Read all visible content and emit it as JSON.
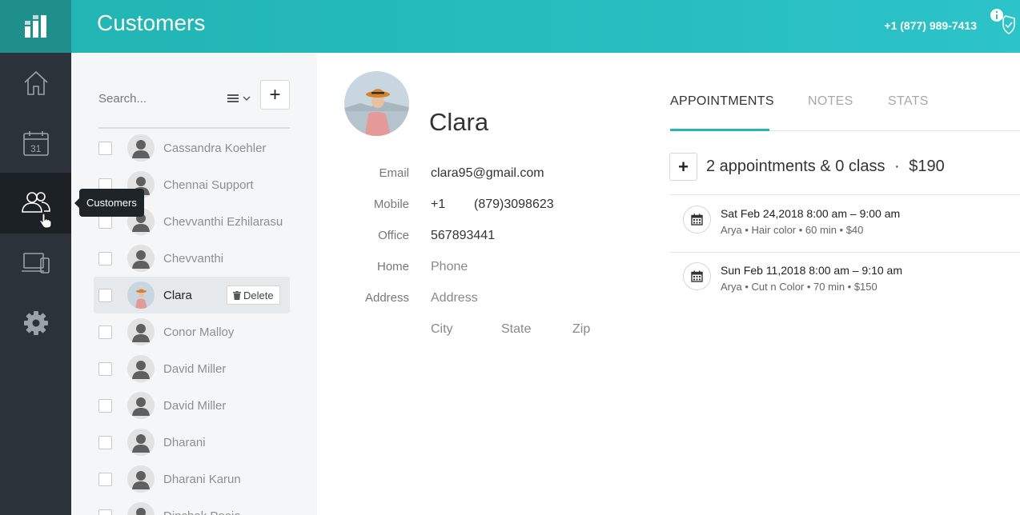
{
  "header": {
    "title": "Customers",
    "phone": "+1 (877) 989-7413",
    "bg_color": "#2cc3c9",
    "info_icon": "info-shield-icon"
  },
  "leftnav": {
    "items": [
      {
        "icon": "home-icon",
        "active": false
      },
      {
        "icon": "calendar-icon",
        "label": "31",
        "active": false
      },
      {
        "icon": "customers-icon",
        "active": true
      },
      {
        "icon": "devices-icon",
        "active": false
      },
      {
        "icon": "gear-icon",
        "active": false
      }
    ],
    "tooltip": "Customers"
  },
  "list": {
    "search_placeholder": "Search...",
    "add_label": "+",
    "delete_label": "Delete",
    "customers": [
      {
        "name": "Cassandra Koehler",
        "selected": false
      },
      {
        "name": "Chennai Support",
        "selected": false
      },
      {
        "name": "Chevvanthi Ezhilarasu",
        "selected": false
      },
      {
        "name": "Chevvanthi",
        "selected": false
      },
      {
        "name": "Clara",
        "selected": true
      },
      {
        "name": "Conor Malloy",
        "selected": false
      },
      {
        "name": "David Miller",
        "selected": false
      },
      {
        "name": "David Miller",
        "selected": false
      },
      {
        "name": "Dharani",
        "selected": false
      },
      {
        "name": "Dharani Karun",
        "selected": false
      },
      {
        "name": "Dinchak Pooja",
        "selected": false
      }
    ]
  },
  "detail": {
    "name": "Clara",
    "labels": {
      "email": "Email",
      "mobile": "Mobile",
      "office": "Office",
      "home": "Home",
      "address": "Address"
    },
    "email": "clara95@gmail.com",
    "mobile_code": "+1",
    "mobile_number": "(879)3098623",
    "office": "567893441",
    "home_placeholder": "Phone",
    "address_placeholder": "Address",
    "city_placeholder": "City",
    "state_placeholder": "State",
    "zip_placeholder": "Zip"
  },
  "tabs": [
    {
      "label": "APPOINTMENTS",
      "active": true
    },
    {
      "label": "NOTES",
      "active": false
    },
    {
      "label": "STATS",
      "active": false
    }
  ],
  "appointments": {
    "add_label": "+",
    "summary": "2 appointments & 0 class",
    "summary_sep": "·",
    "total": "$190",
    "items": [
      {
        "title": "Sat Feb 24,2018 8:00 am – 9:00 am",
        "subtitle": "Arya • Hair color • 60 min • $40"
      },
      {
        "title": "Sun Feb 11,2018 8:00 am – 9:10 am",
        "subtitle": "Arya • Cut n Color • 70 min • $150"
      }
    ]
  }
}
